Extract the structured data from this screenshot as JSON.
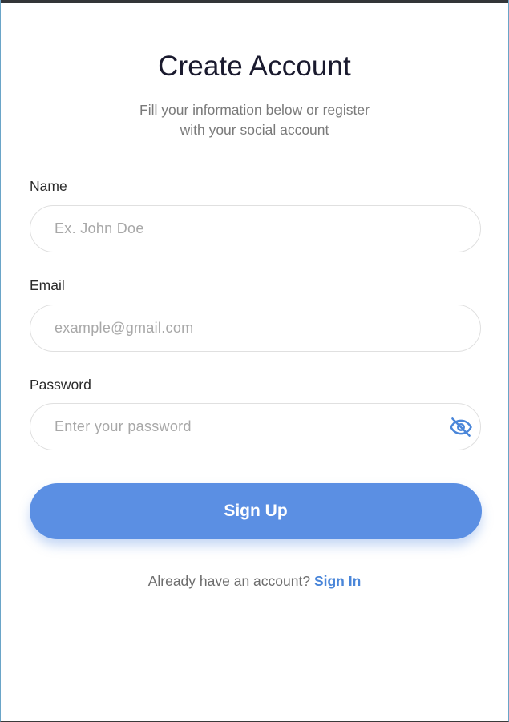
{
  "header": {
    "title": "Create Account",
    "subtitle_line1": "Fill your information below or register",
    "subtitle_line2": "with your social account"
  },
  "form": {
    "name": {
      "label": "Name",
      "value": "",
      "placeholder": "Ex. John Doe"
    },
    "email": {
      "label": "Email",
      "value": "",
      "placeholder": "example@gmail.com"
    },
    "password": {
      "label": "Password",
      "value": "",
      "placeholder": "Enter your password",
      "visibility_icon": "eye-off-icon"
    },
    "submit_label": "Sign Up"
  },
  "footer": {
    "prompt": "Already have an account?",
    "link_label": "Sign In"
  },
  "colors": {
    "primary": "#5b8fe3",
    "link": "#4a86d9",
    "title": "#1a1a2e",
    "muted": "#7a7a7a",
    "input_border": "#e0e0e0"
  }
}
